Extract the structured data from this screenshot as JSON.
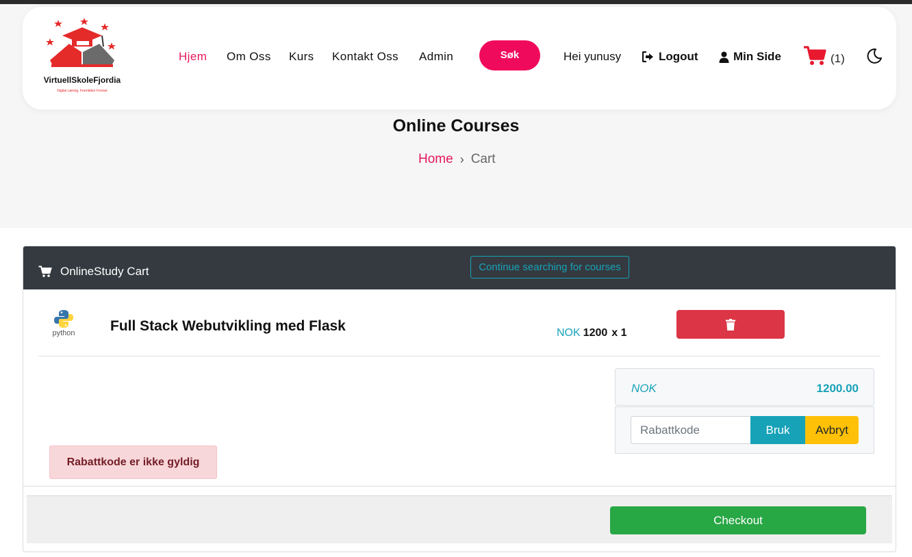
{
  "brand": {
    "name": "VirtuellSkoleFjordia",
    "tagline": "Digital Læring, Fremtiden Formet"
  },
  "nav": {
    "home": "Hjem",
    "about": "Om Oss",
    "courses": "Kurs",
    "contact": "Kontakt Oss",
    "admin": "Admin",
    "search": "Søk",
    "greeting": "Hei yunusy",
    "logout": "Logout",
    "my_page": "Min Side",
    "cart_count": "(1)"
  },
  "page": {
    "title": "Online Courses",
    "breadcrumb_home": "Home",
    "breadcrumb_current": "Cart"
  },
  "cart": {
    "header_title": "OnlineStudy Cart",
    "continue_label": "Continue searching for courses",
    "item": {
      "logo_text": "python",
      "title": "Full Stack Webutvikling med Flask",
      "currency": "NOK",
      "price": "1200",
      "quantity": "x 1"
    },
    "total_currency": "NOK",
    "total_amount": "1200.00",
    "coupon_placeholder": "Rabattkode",
    "apply_label": "Bruk",
    "cancel_label": "Avbryt",
    "alert_text": "Rabattkode er ikke gyldig",
    "checkout_label": "Checkout"
  },
  "colors": {
    "accent": "#e3175f",
    "search_button": "#f00a5c",
    "cart_icon": "#e8182e",
    "header_dark": "#343a40",
    "info": "#17a2b8",
    "danger": "#dc3545",
    "warning": "#ffc107",
    "success": "#28a745"
  },
  "icons": {
    "logout": "sign-out-icon",
    "my_page": "user-icon",
    "cart": "shopping-cart-icon",
    "theme": "moon-icon",
    "delete": "trash-icon"
  }
}
